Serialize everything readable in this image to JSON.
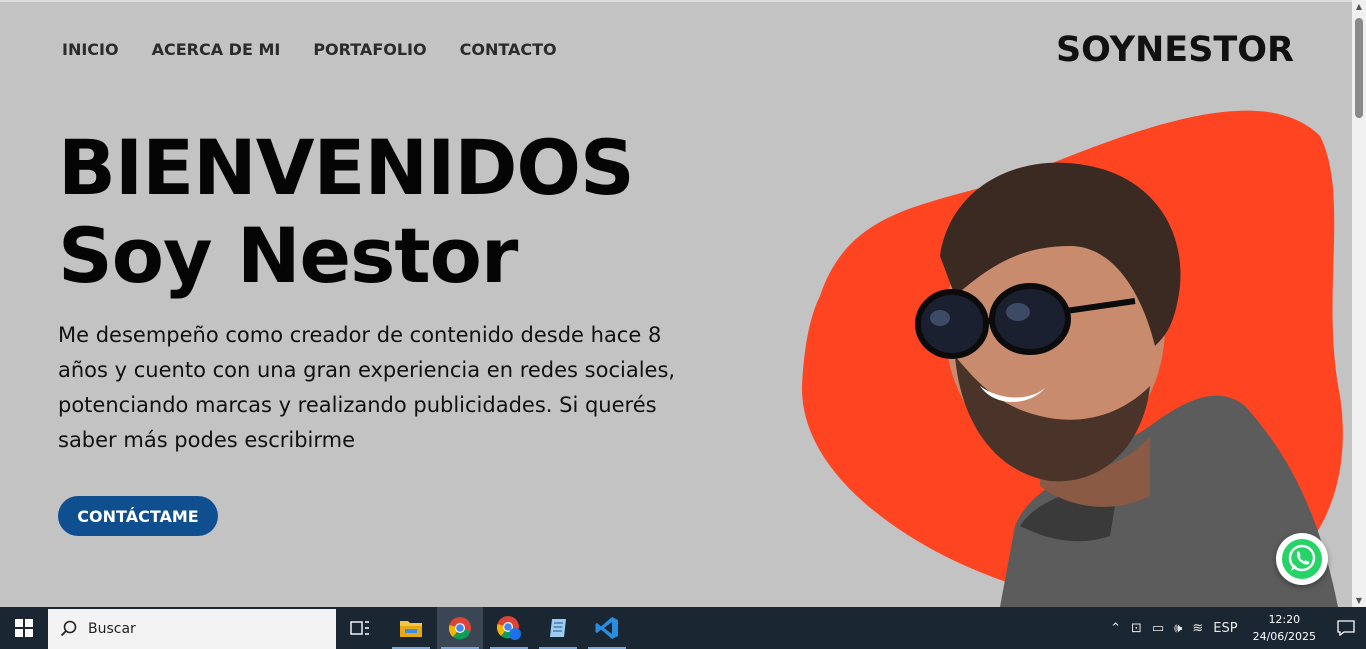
{
  "nav": {
    "items": [
      {
        "label": "INICIO"
      },
      {
        "label": "ACERCA DE MI"
      },
      {
        "label": "PORTAFOLIO"
      },
      {
        "label": "CONTACTO"
      }
    ]
  },
  "brand": "SOYNESTOR",
  "hero": {
    "title_line1": "BIENVENIDOS",
    "title_line2": "Soy Nestor",
    "description": "Me desempeño como creador de contenido desde hace 8 años y cuento con una gran experiencia en redes sociales, potenciando marcas y realizando publicidades. Si querés saber más podes escribirme",
    "cta_label": "CONTÁCTAME"
  },
  "colors": {
    "page_bg": "#c3c3c3",
    "blob": "#ff4422",
    "cta_bg": "#0f4f8f",
    "whatsapp": "#25d366"
  },
  "icons": {
    "whatsapp": "whatsapp-icon",
    "windows_start": "windows-icon",
    "search": "search-icon"
  },
  "taskbar": {
    "search_placeholder": "Buscar",
    "language": "ESP",
    "time": "12:20",
    "date": "24/06/2025"
  }
}
